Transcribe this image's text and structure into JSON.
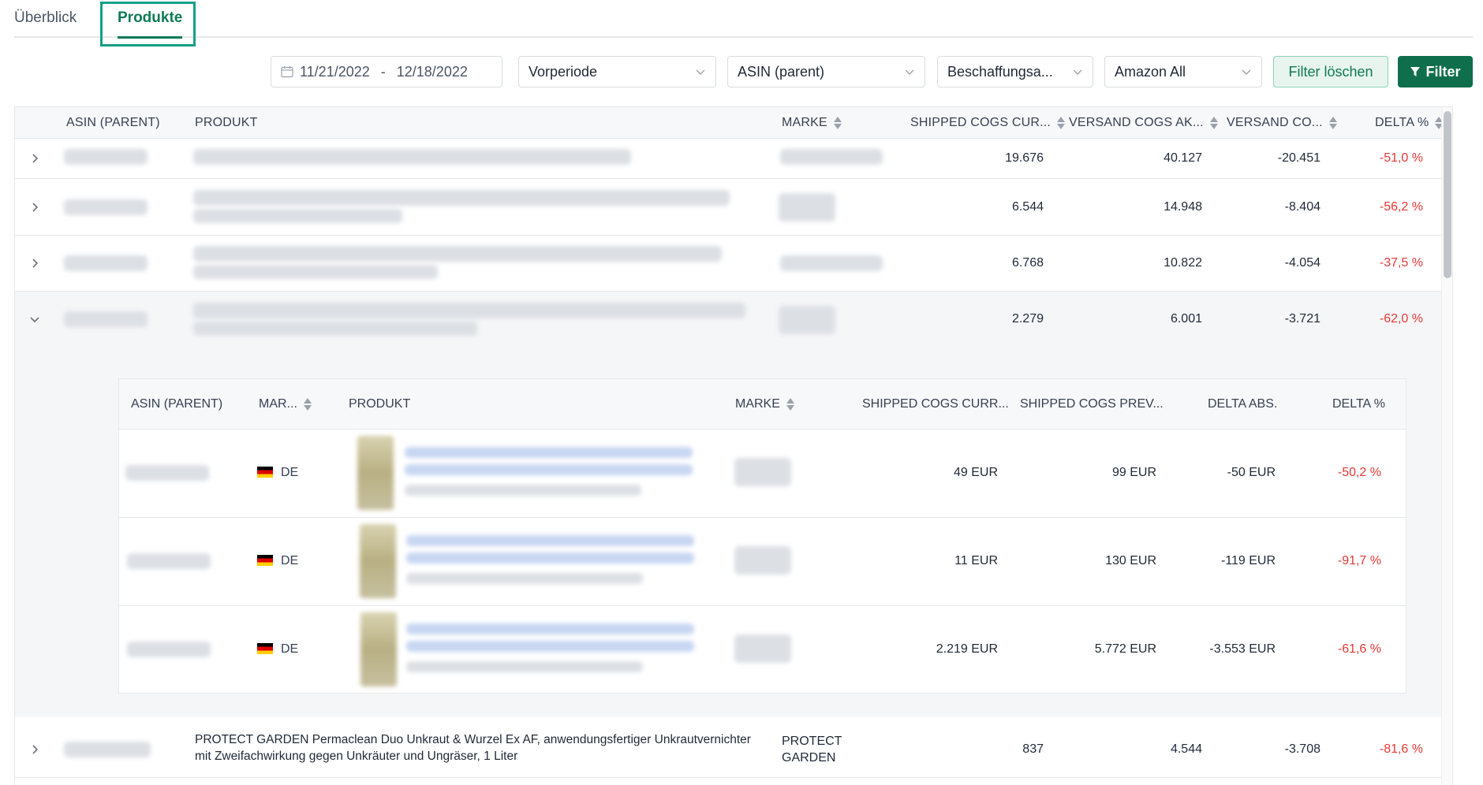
{
  "tabs": [
    {
      "label": "Überblick",
      "active": false
    },
    {
      "label": "Produkte",
      "active": true
    }
  ],
  "filters": {
    "date_start": "11/21/2022",
    "date_separator": "-",
    "date_end": "12/18/2022",
    "period_select": "Vorperiode",
    "asin_select": "ASIN (parent)",
    "procurement_select": "Beschaffungsa...",
    "marketplace_select": "Amazon All",
    "clear_button": "Filter löschen",
    "filter_button": "Filter"
  },
  "table": {
    "columns": {
      "asin": "ASIN (PARENT)",
      "product": "PRODUKT",
      "brand": "MARKE",
      "shipped_cogs_current": "SHIPPED COGS CUR...",
      "versand_cogs_prev": "VERSAND COGS AK...",
      "versand_cogs_delta": "VERSAND CO...",
      "delta_pct": "DELTA %"
    },
    "rows": [
      {
        "shipped": "19.676",
        "prev": "40.127",
        "delta_abs": "-20.451",
        "delta_pct": "-51,0 %"
      },
      {
        "shipped": "6.544",
        "prev": "14.948",
        "delta_abs": "-8.404",
        "delta_pct": "-56,2 %"
      },
      {
        "shipped": "6.768",
        "prev": "10.822",
        "delta_abs": "-4.054",
        "delta_pct": "-37,5 %"
      },
      {
        "shipped": "2.279",
        "prev": "6.001",
        "delta_abs": "-3.721",
        "delta_pct": "-62,0 %"
      }
    ],
    "last_row": {
      "product_line1": "PROTECT GARDEN Permaclean Duo Unkraut & Wurzel Ex AF, anwendungsfertiger Unkrautvernichter",
      "product_line2": "mit Zweifachwirkung gegen Unkräuter und Ungräser, 1 Liter",
      "brand_line1": "PROTECT",
      "brand_line2": "GARDEN",
      "shipped": "837",
      "prev": "4.544",
      "delta_abs": "-3.708",
      "delta_pct": "-81,6 %"
    }
  },
  "subtable": {
    "columns": {
      "asin": "ASIN (PARENT)",
      "marketplace": "MAR...",
      "product": "PRODUKT",
      "brand": "MARKE",
      "shipped_current": "SHIPPED COGS CURR...",
      "shipped_prev": "SHIPPED COGS PREV...",
      "delta_abs": "DELTA ABS.",
      "delta_pct": "DELTA %"
    },
    "rows": [
      {
        "marketplace": "DE",
        "current": "49 EUR",
        "prev": "99 EUR",
        "delta_abs": "-50 EUR",
        "delta_pct": "-50,2 %"
      },
      {
        "marketplace": "DE",
        "current": "11 EUR",
        "prev": "130 EUR",
        "delta_abs": "-119 EUR",
        "delta_pct": "-91,7 %"
      },
      {
        "marketplace": "DE",
        "current": "2.219 EUR",
        "prev": "5.772 EUR",
        "delta_abs": "-3.553 EUR",
        "delta_pct": "-61,6 %"
      }
    ]
  },
  "colors": {
    "accent": "#0f7a55",
    "highlight_box": "#14a085",
    "negative": "#e53935"
  }
}
